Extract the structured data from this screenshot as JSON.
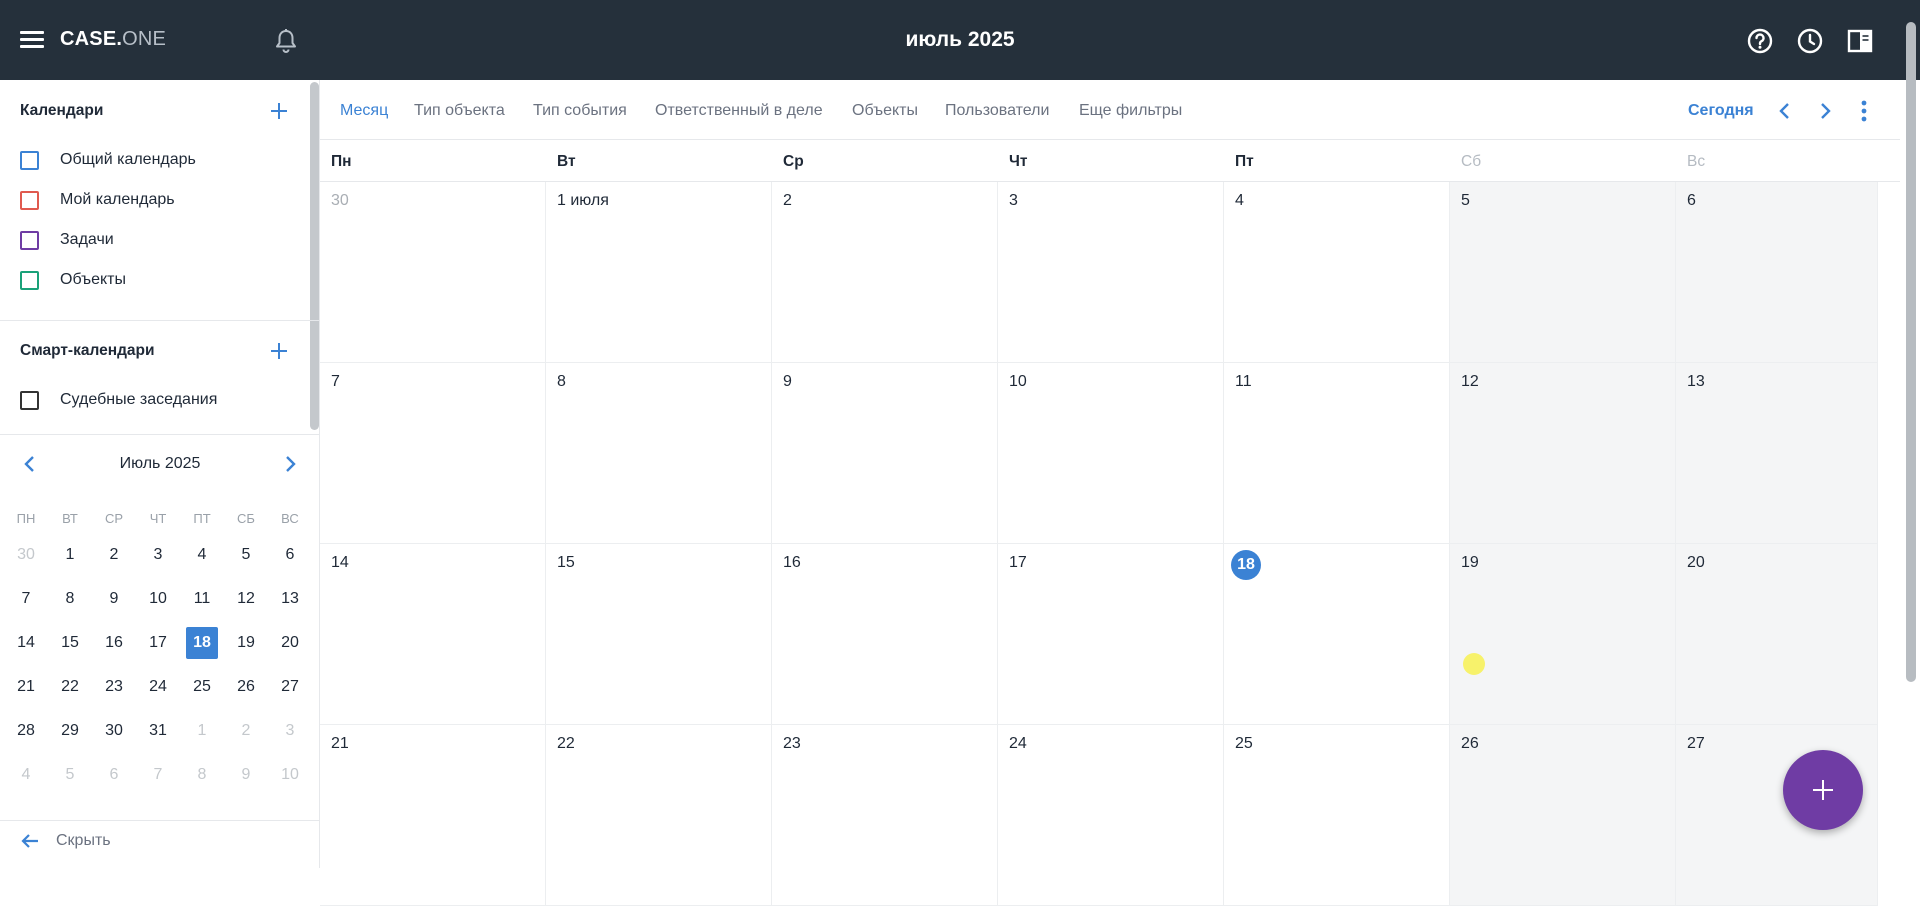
{
  "app": {
    "logo_bold": "CASE",
    "logo_dot": ".",
    "logo_light": "ONE",
    "title": "июль 2025"
  },
  "sidebar": {
    "calendars_title": "Календари",
    "calendars": [
      {
        "label": "Общий календарь",
        "color": "#3b82d4"
      },
      {
        "label": "Мой календарь",
        "color": "#e05a4f"
      },
      {
        "label": "Задачи",
        "color": "#6f3ca4"
      },
      {
        "label": "Объекты",
        "color": "#1aa179"
      }
    ],
    "smart_title": "Смарт-календари",
    "smart": [
      {
        "label": "Судебные заседания",
        "color": "#333333"
      }
    ],
    "mini": {
      "title": "Июль 2025",
      "weekdays": [
        "ПН",
        "ВТ",
        "СР",
        "ЧТ",
        "ПТ",
        "СБ",
        "ВС"
      ],
      "weeks": [
        [
          "30",
          "1",
          "2",
          "3",
          "4",
          "5",
          "6"
        ],
        [
          "7",
          "8",
          "9",
          "10",
          "11",
          "12",
          "13"
        ],
        [
          "14",
          "15",
          "16",
          "17",
          "18",
          "19",
          "20"
        ],
        [
          "21",
          "22",
          "23",
          "24",
          "25",
          "26",
          "27"
        ],
        [
          "28",
          "29",
          "30",
          "31",
          "1",
          "2",
          "3"
        ],
        [
          "4",
          "5",
          "6",
          "7",
          "8",
          "9",
          "10"
        ]
      ],
      "selected": "18"
    },
    "hide_label": "Скрыть"
  },
  "filters": {
    "items": [
      "Месяц",
      "Тип объекта",
      "Тип события",
      "Ответственный в деле",
      "Объекты",
      "Пользователи",
      "Еще фильтры"
    ],
    "active_index": 0,
    "today_label": "Сегодня"
  },
  "month": {
    "weekdays": [
      "Пн",
      "Вт",
      "Ср",
      "Чт",
      "Пт",
      "Сб",
      "Вс"
    ],
    "weeks": [
      [
        "30",
        "1 июля",
        "2",
        "3",
        "4",
        "5",
        "6"
      ],
      [
        "7",
        "8",
        "9",
        "10",
        "11",
        "12",
        "13"
      ],
      [
        "14",
        "15",
        "16",
        "17",
        "18",
        "19",
        "20"
      ],
      [
        "21",
        "22",
        "23",
        "24",
        "25",
        "26",
        "27"
      ]
    ],
    "today": "18"
  },
  "colors": {
    "topbar": "#25303b",
    "accent": "#3b82d4",
    "fab": "#6f3ca4"
  }
}
